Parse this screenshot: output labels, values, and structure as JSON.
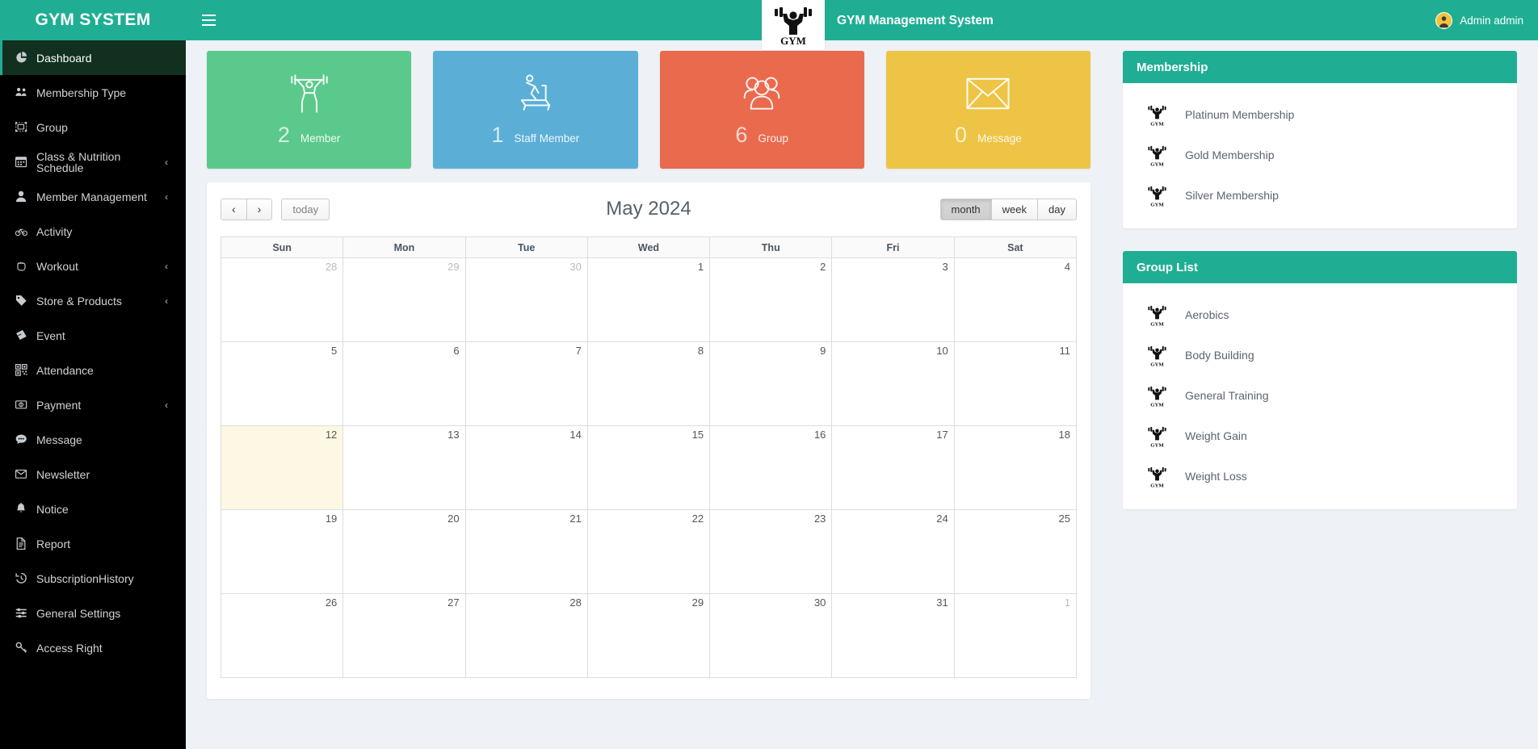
{
  "header": {
    "brand": "GYM SYSTEM",
    "menu_toggle": "menu-icon",
    "logo_alt": "GYM",
    "logo_word": "GYM",
    "app_title": "GYM Management System",
    "admin_name": "Admin admin"
  },
  "sidebar": {
    "items": [
      {
        "label": "Dashboard",
        "icon": "pie-chart-icon",
        "active": true,
        "caret": ""
      },
      {
        "label": "Membership Type",
        "icon": "users-icon",
        "active": false,
        "caret": ""
      },
      {
        "label": "Group",
        "icon": "object-group-icon",
        "active": false,
        "caret": ""
      },
      {
        "label": "Class & Nutrition Schedule",
        "icon": "calendar-icon",
        "active": false,
        "caret": "‹"
      },
      {
        "label": "Member Management",
        "icon": "user-icon",
        "active": false,
        "caret": "‹"
      },
      {
        "label": "Activity",
        "icon": "bicycle-icon",
        "active": false,
        "caret": ""
      },
      {
        "label": "Workout",
        "icon": "hand-rock-icon",
        "active": false,
        "caret": "‹"
      },
      {
        "label": "Store & Products",
        "icon": "tag-icon",
        "active": false,
        "caret": "‹"
      },
      {
        "label": "Event",
        "icon": "ticket-icon",
        "active": false,
        "caret": ""
      },
      {
        "label": "Attendance",
        "icon": "qrcode-icon",
        "active": false,
        "caret": ""
      },
      {
        "label": "Payment",
        "icon": "money-icon",
        "active": false,
        "caret": "‹"
      },
      {
        "label": "Message",
        "icon": "comment-icon",
        "active": false,
        "caret": ""
      },
      {
        "label": "Newsletter",
        "icon": "envelope-icon",
        "active": false,
        "caret": ""
      },
      {
        "label": "Notice",
        "icon": "bell-icon",
        "active": false,
        "caret": ""
      },
      {
        "label": "Report",
        "icon": "file-text-icon",
        "active": false,
        "caret": ""
      },
      {
        "label": "SubscriptionHistory",
        "icon": "history-icon",
        "active": false,
        "caret": ""
      },
      {
        "label": "General Settings",
        "icon": "sliders-icon",
        "active": false,
        "caret": ""
      },
      {
        "label": "Access Right",
        "icon": "key-icon",
        "active": false,
        "caret": ""
      }
    ]
  },
  "stats": [
    {
      "count": "2",
      "label": "Member",
      "icon": "weightlifter-icon",
      "color": "#5cc98c"
    },
    {
      "count": "1",
      "label": "Staff Member",
      "icon": "treadmill-icon",
      "color": "#5bafd6"
    },
    {
      "count": "6",
      "label": "Group",
      "icon": "people-icon",
      "color": "#ea6a4e"
    },
    {
      "count": "0",
      "label": "Message",
      "icon": "envelope-icon",
      "color": "#edc445"
    }
  ],
  "calendar": {
    "prev_label": "‹",
    "next_label": "›",
    "today_label": "today",
    "title": "May 2024",
    "views": [
      {
        "label": "month",
        "active": true
      },
      {
        "label": "week",
        "active": false
      },
      {
        "label": "day",
        "active": false
      }
    ],
    "day_headers": [
      "Sun",
      "Mon",
      "Tue",
      "Wed",
      "Thu",
      "Fri",
      "Sat"
    ],
    "weeks": [
      [
        {
          "n": "28",
          "other": true,
          "today": false
        },
        {
          "n": "29",
          "other": true,
          "today": false
        },
        {
          "n": "30",
          "other": true,
          "today": false
        },
        {
          "n": "1",
          "other": false,
          "today": false
        },
        {
          "n": "2",
          "other": false,
          "today": false
        },
        {
          "n": "3",
          "other": false,
          "today": false
        },
        {
          "n": "4",
          "other": false,
          "today": false
        }
      ],
      [
        {
          "n": "5",
          "other": false,
          "today": false
        },
        {
          "n": "6",
          "other": false,
          "today": false
        },
        {
          "n": "7",
          "other": false,
          "today": false
        },
        {
          "n": "8",
          "other": false,
          "today": false
        },
        {
          "n": "9",
          "other": false,
          "today": false
        },
        {
          "n": "10",
          "other": false,
          "today": false
        },
        {
          "n": "11",
          "other": false,
          "today": false
        }
      ],
      [
        {
          "n": "12",
          "other": false,
          "today": true
        },
        {
          "n": "13",
          "other": false,
          "today": false
        },
        {
          "n": "14",
          "other": false,
          "today": false
        },
        {
          "n": "15",
          "other": false,
          "today": false
        },
        {
          "n": "16",
          "other": false,
          "today": false
        },
        {
          "n": "17",
          "other": false,
          "today": false
        },
        {
          "n": "18",
          "other": false,
          "today": false
        }
      ],
      [
        {
          "n": "19",
          "other": false,
          "today": false
        },
        {
          "n": "20",
          "other": false,
          "today": false
        },
        {
          "n": "21",
          "other": false,
          "today": false
        },
        {
          "n": "22",
          "other": false,
          "today": false
        },
        {
          "n": "23",
          "other": false,
          "today": false
        },
        {
          "n": "24",
          "other": false,
          "today": false
        },
        {
          "n": "25",
          "other": false,
          "today": false
        }
      ],
      [
        {
          "n": "26",
          "other": false,
          "today": false
        },
        {
          "n": "27",
          "other": false,
          "today": false
        },
        {
          "n": "28",
          "other": false,
          "today": false
        },
        {
          "n": "29",
          "other": false,
          "today": false
        },
        {
          "n": "30",
          "other": false,
          "today": false
        },
        {
          "n": "31",
          "other": false,
          "today": false
        },
        {
          "n": "1",
          "other": true,
          "today": false
        }
      ]
    ]
  },
  "membership_panel": {
    "title": "Membership",
    "items": [
      {
        "label": "Platinum Membership",
        "icon": "gym-logo-icon"
      },
      {
        "label": "Gold Membership",
        "icon": "gym-logo-icon"
      },
      {
        "label": "Silver Membership",
        "icon": "gym-logo-icon"
      }
    ]
  },
  "group_panel": {
    "title": "Group List",
    "items": [
      {
        "label": "Aerobics",
        "icon": "gym-logo-icon"
      },
      {
        "label": "Body Building",
        "icon": "gym-logo-icon"
      },
      {
        "label": "General Training",
        "icon": "gym-logo-icon"
      },
      {
        "label": "Weight Gain",
        "icon": "gym-logo-icon"
      },
      {
        "label": "Weight Loss",
        "icon": "gym-logo-icon"
      }
    ]
  },
  "colors": {
    "primary": "#1fae94",
    "sidebar_bg": "#000000",
    "sidebar_active": "#11301f",
    "page_bg": "#eef1f5",
    "today_bg": "#fcf8e3"
  }
}
